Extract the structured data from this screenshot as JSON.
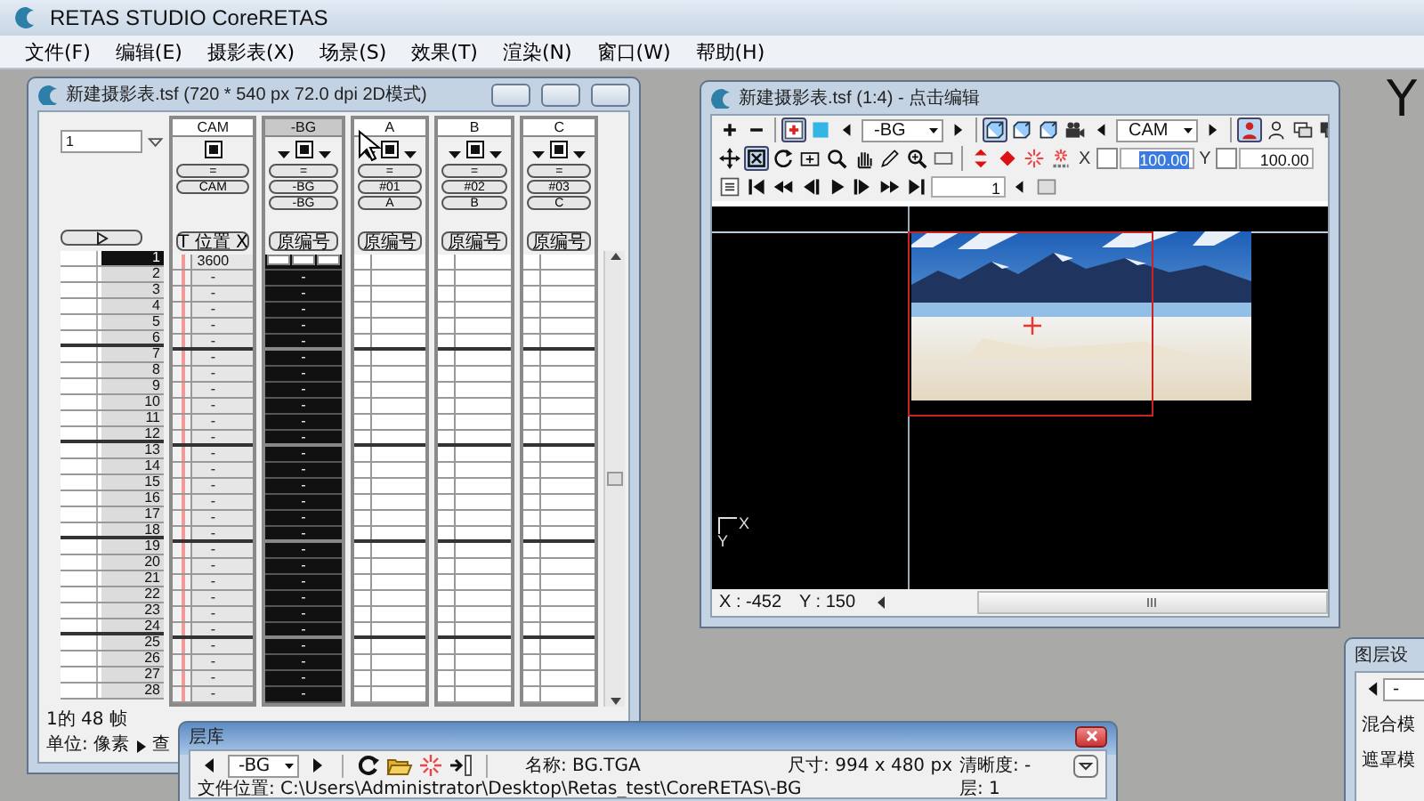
{
  "app": {
    "title": "RETAS STUDIO CoreRETAS",
    "corner_text": "Y"
  },
  "menu": [
    "文件(F)",
    "编辑(E)",
    "摄影表(X)",
    "场景(S)",
    "效果(T)",
    "渲染(N)",
    "窗口(W)",
    "帮助(H)"
  ],
  "sheet_window": {
    "title": "新建摄影表.tsf (720 * 540 px 72.0 dpi 2D模式)",
    "frame_field": "1",
    "layers": [
      {
        "name": "CAM",
        "kind": "camera",
        "selected": false,
        "eq": "=",
        "cel": "CAM",
        "mode": "T 位置 X",
        "cells": [
          "3600",
          "-",
          "-",
          "-",
          "-",
          "-",
          "-",
          "-",
          "-",
          "-",
          "-",
          "-",
          "-",
          "-",
          "-",
          "-",
          "-",
          "-",
          "-",
          "-",
          "-",
          "-",
          "-",
          "-",
          "-",
          "-",
          "-",
          "-"
        ]
      },
      {
        "name": "-BG",
        "kind": "cel",
        "selected": true,
        "eq": "=",
        "cel": "-BG",
        "sub": "-BG",
        "mode": "原编号",
        "cells": [
          null,
          "-",
          "-",
          "-",
          "-",
          "-",
          "-",
          "-",
          "-",
          "-",
          "-",
          "-",
          "-",
          "-",
          "-",
          "-",
          "-",
          "-",
          "-",
          "-",
          "-",
          "-",
          "-",
          "-",
          "-",
          "-",
          "-",
          "-"
        ]
      },
      {
        "name": "A",
        "kind": "cel",
        "selected": false,
        "eq": "=",
        "cel": "#01",
        "sub": "A",
        "mode": "原编号"
      },
      {
        "name": "B",
        "kind": "cel",
        "selected": false,
        "eq": "=",
        "cel": "#02",
        "sub": "B",
        "mode": "原编号"
      },
      {
        "name": "C",
        "kind": "cel",
        "selected": false,
        "eq": "=",
        "cel": "#03",
        "sub": "C",
        "mode": "原编号"
      }
    ],
    "frames": [
      {
        "label": "1",
        "selected": true
      },
      {
        "label": "2",
        "selected": false
      },
      {
        "label": "3",
        "selected": false
      },
      {
        "label": "4",
        "selected": false
      },
      {
        "label": "5",
        "selected": false
      },
      {
        "label": "6",
        "selected": false
      },
      {
        "label": "7",
        "selected": false
      },
      {
        "label": "8",
        "selected": false
      },
      {
        "label": "9",
        "selected": false
      },
      {
        "label": "10",
        "selected": false
      },
      {
        "label": "11",
        "selected": false
      },
      {
        "label": "12",
        "selected": false
      },
      {
        "label": "13",
        "selected": false
      },
      {
        "label": "14",
        "selected": false
      },
      {
        "label": "15",
        "selected": false
      },
      {
        "label": "16",
        "selected": false
      },
      {
        "label": "17",
        "selected": false
      },
      {
        "label": "18",
        "selected": false
      },
      {
        "label": "19",
        "selected": false
      },
      {
        "label": "20",
        "selected": false
      },
      {
        "label": "21",
        "selected": false
      },
      {
        "label": "22",
        "selected": false
      },
      {
        "label": "23",
        "selected": false
      },
      {
        "label": "24",
        "selected": false
      },
      {
        "label": "25",
        "selected": false
      },
      {
        "label": "26",
        "selected": false
      },
      {
        "label": "27",
        "selected": false
      },
      {
        "label": "28",
        "selected": false
      }
    ],
    "frame_count": "1的 48 帧",
    "unit_label": "单位: 像素",
    "next_label": "查"
  },
  "viewer_window": {
    "title": "新建摄影表.tsf (1:4) - 点击编辑",
    "toolbars": [
      [
        {
          "kind": "plus",
          "selected": false
        },
        {
          "kind": "minus",
          "selected": false
        },
        {
          "kind": "sep"
        },
        {
          "kind": "addlayer",
          "selected": true
        },
        {
          "kind": "square",
          "selected": false
        },
        {
          "kind": "left"
        },
        {
          "kind": "dropdown",
          "value": "-BG"
        },
        {
          "kind": "right"
        },
        {
          "kind": "sep"
        },
        {
          "kind": "cube",
          "selected": true
        },
        {
          "kind": "cube",
          "selected": false
        },
        {
          "kind": "cube",
          "selected": false
        },
        {
          "kind": "camera",
          "selected": false
        },
        {
          "kind": "left"
        },
        {
          "kind": "dropdown",
          "value": "CAM"
        },
        {
          "kind": "right"
        },
        {
          "kind": "sep"
        },
        {
          "kind": "person",
          "selected": true
        },
        {
          "kind": "person2",
          "selected": false
        },
        {
          "kind": "win",
          "selected": false
        },
        {
          "kind": "win2",
          "selected": false
        }
      ],
      [
        {
          "kind": "move",
          "selected": false
        },
        {
          "kind": "fit",
          "selected": true
        },
        {
          "kind": "rotate",
          "selected": false
        },
        {
          "kind": "zoomrect",
          "selected": false
        },
        {
          "kind": "search",
          "selected": false
        },
        {
          "kind": "hand",
          "selected": false
        },
        {
          "kind": "pen",
          "selected": false
        },
        {
          "kind": "zoomsearch",
          "selected": false
        },
        {
          "kind": "rect",
          "selected": false
        },
        {
          "kind": "sep"
        },
        {
          "kind": "updown",
          "selected": false
        },
        {
          "kind": "diamond",
          "selected": false
        },
        {
          "kind": "burst",
          "selected": false
        },
        {
          "kind": "burstxyz",
          "selected": false
        },
        {
          "kind": "label",
          "text": "X"
        },
        {
          "kind": "check",
          "checked": false
        },
        {
          "kind": "field",
          "value": "100.00",
          "selected": true
        },
        {
          "kind": "label",
          "text": "Y"
        },
        {
          "kind": "check",
          "checked": false
        },
        {
          "kind": "field",
          "value": "100.00",
          "selected": false
        }
      ],
      [
        {
          "kind": "list",
          "selected": false
        },
        {
          "kind": "first",
          "selected": false
        },
        {
          "kind": "prevkey",
          "selected": false
        },
        {
          "kind": "prev",
          "selected": false
        },
        {
          "kind": "play",
          "selected": false
        },
        {
          "kind": "next",
          "selected": false
        },
        {
          "kind": "nextkey",
          "selected": false
        },
        {
          "kind": "last",
          "selected": false
        },
        {
          "kind": "field",
          "value": "1",
          "selected": false
        },
        {
          "kind": "left"
        },
        {
          "kind": "box",
          "selected": false
        }
      ]
    ],
    "axis_x": "X",
    "axis_y": "Y",
    "status_x": "X : -452",
    "status_y": "Y : 150"
  },
  "library_window": {
    "title": "层库",
    "layer_select": "-BG",
    "name": "名称: BG.TGA",
    "size": "尺寸: 994 x 480 px",
    "clarity": "清晰度: -",
    "layer": "层: 1",
    "path": "文件位置: C:\\Users\\Administrator\\Desktop\\Retas_test\\CoreRETAS\\-BG"
  },
  "layer_settings_window": {
    "title": "图层设",
    "select": "-",
    "rows": [
      "混合模",
      "遮罩模"
    ]
  }
}
